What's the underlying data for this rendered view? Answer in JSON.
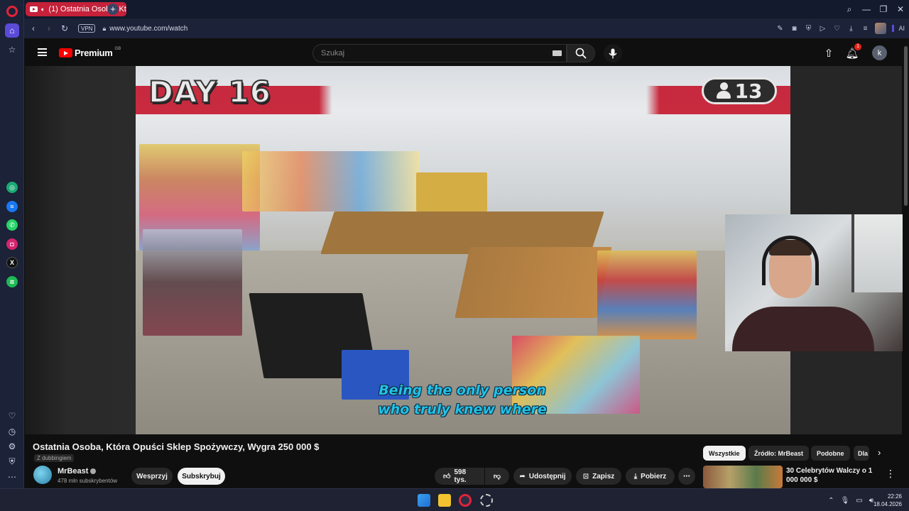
{
  "browser": {
    "tab_title": "(1) Ostatnia Osoba, Kt",
    "url": "www.youtube.com/watch",
    "vpn_label": "VPN",
    "ai_label": "AI"
  },
  "youtube": {
    "logo_text": "Premium",
    "logo_country": "GB",
    "search_placeholder": "Szukaj",
    "notification_count": "1",
    "account_initial": "k"
  },
  "video": {
    "overlay_day": "DAY 16",
    "overlay_count": "13",
    "subtitle_line1": "Being the only person",
    "subtitle_line2": "who truly knew where",
    "title": "Ostatnia Osoba, Która Opuści Sklep Spożywczy, Wygra 250 000 $",
    "dub_label": "Z dubbingiem"
  },
  "channel": {
    "name": "MrBeast",
    "subscribers": "478 mln subskrybentów",
    "join_label": "Wesprzyj",
    "subscribe_label": "Subskrybuj"
  },
  "actions": {
    "likes": "598 tys.",
    "share": "Udostępnij",
    "save": "Zapisz",
    "download": "Pobierz"
  },
  "chips": [
    "Wszystkie",
    "Źródło: MrBeast",
    "Podobne",
    "Dla"
  ],
  "recommendation": {
    "title": "30 Celebrytów Walczy o 1 000 000 $"
  },
  "taskbar": {
    "time": "22:26",
    "date": "18.04.2026"
  },
  "colors": {
    "yt_red": "#ff0000",
    "opera_red": "#c5213a",
    "subtitle": "#22c2e6"
  }
}
